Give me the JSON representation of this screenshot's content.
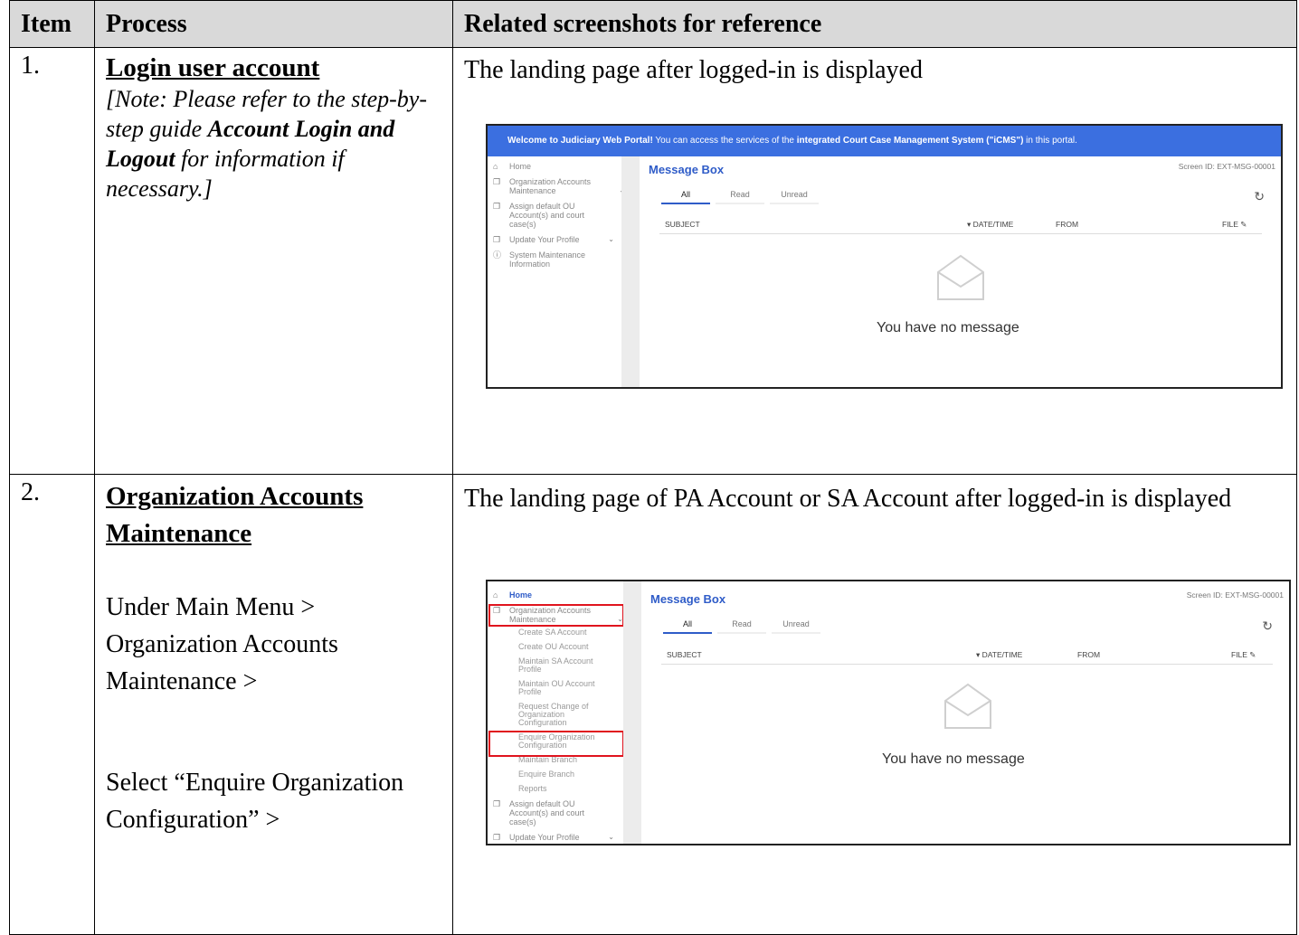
{
  "table": {
    "headers": [
      "Item",
      "Process",
      "Related screenshots for reference"
    ],
    "rows": [
      {
        "item": "1.",
        "title": "Login user account",
        "note_pre": "[Note: Please refer to the step-by-step guide ",
        "note_bold": "Account Login and Logout",
        "note_post": " for information if necessary.]",
        "caption": "The landing page after logged-in is displayed"
      },
      {
        "item": "2.",
        "title": "Organization Accounts Maintenance",
        "step1": "Under Main Menu >",
        "step2": "Organization Accounts Maintenance >",
        "step3": "Select “Enquire Organization Configuration” >",
        "caption": "The landing page of PA Account or SA Account after logged-in is displayed"
      }
    ]
  },
  "screenshot1": {
    "banner_pre": "Welcome to Judiciary Web Portal!",
    "banner_mid": "  You can access the services of the ",
    "banner_bold": "integrated Court Case Management System (\"iCMS\")",
    "banner_post": " in this portal.",
    "menu": [
      "Home",
      "Organization Accounts Maintenance",
      "Assign default OU Account(s) and court case(s)",
      "Update Your Profile",
      "System Maintenance Information"
    ],
    "title": "Message Box",
    "screen_id": "Screen ID: EXT-MSG-00001",
    "tabs": [
      "All",
      "Read",
      "Unread"
    ],
    "columns": [
      "SUBJECT",
      "▾ DATE/TIME",
      "FROM",
      "FILE ✎"
    ],
    "empty": "You have no message"
  },
  "screenshot2": {
    "menu_home": "Home",
    "menu_oam": "Organization Accounts Maintenance",
    "submenu": [
      "Create SA Account",
      "Create OU Account",
      "Maintain SA Account Profile",
      "Maintain OU Account Profile",
      "Request Change of Organization Configuration",
      "Enquire Organization Configuration",
      "Maintain Branch",
      "Enquire Branch",
      "Reports"
    ],
    "menu_assign": "Assign default OU Account(s) and court case(s)",
    "menu_profile": "Update Your Profile",
    "title": "Message Box",
    "screen_id": "Screen ID: EXT-MSG-00001",
    "tabs": [
      "All",
      "Read",
      "Unread"
    ],
    "columns": [
      "SUBJECT",
      "▾ DATE/TIME",
      "FROM",
      "FILE ✎"
    ],
    "empty": "You have no message"
  },
  "colors": {
    "banner": "#3b6fe0",
    "accent": "#2f5cc8",
    "highlight": "#e0141e",
    "header_bg": "#d9d9d9"
  }
}
